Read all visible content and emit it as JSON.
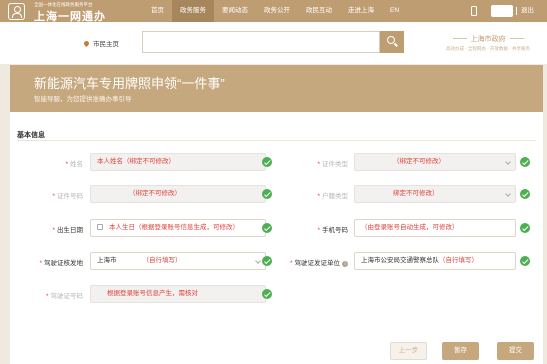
{
  "header": {
    "logo_sub": "全国一体化在线政务服务平台",
    "logo_title": "上海一网通办",
    "nav": [
      "首页",
      "政务服务",
      "要闻动态",
      "政务公开",
      "政民互动",
      "走进上海",
      "EN"
    ],
    "logout": "退出"
  },
  "search": {
    "location": "市民主页",
    "placeholder": ""
  },
  "slogan": {
    "title": "上海市政府",
    "subtitle": "高效办成  ·  全程网办  ·  开放数据  ·  共享服务"
  },
  "banner": {
    "title": "新能源汽车专用牌照申领“一件事”",
    "subtitle": "智能导服，为您提供准确办事引导"
  },
  "form": {
    "section": "基本信息",
    "fields": {
      "name": {
        "label": "姓名",
        "value": "本人姓名（绑定不可修改）"
      },
      "id_type": {
        "label": "证件类型",
        "value": "（绑定不可修改）"
      },
      "id_number": {
        "label": "证件号码",
        "value": "（绑定不可修改）"
      },
      "hukou": {
        "label": "户籍类型",
        "value": "绑定不可修改）"
      },
      "birth": {
        "label": "出生日期",
        "value": "本人生日（根据登录账号信息生成，可修改）"
      },
      "phone": {
        "label": "手机号码",
        "value": "（由登录账号自动生成，可修改）"
      },
      "license_place": {
        "label": "驾驶证核发地",
        "value": "上海市",
        "hint": "（自行填写）"
      },
      "license_unit": {
        "label": "驾驶证发证单位",
        "value": "上海市公安局交通警察总队",
        "hint": "（自行填写）"
      },
      "license_no": {
        "label": "驾驶证号码",
        "value": "根据登录账号信息产生，需核对"
      }
    }
  },
  "actions": {
    "prev": "上一步",
    "save": "暂存",
    "submit": "提交"
  }
}
